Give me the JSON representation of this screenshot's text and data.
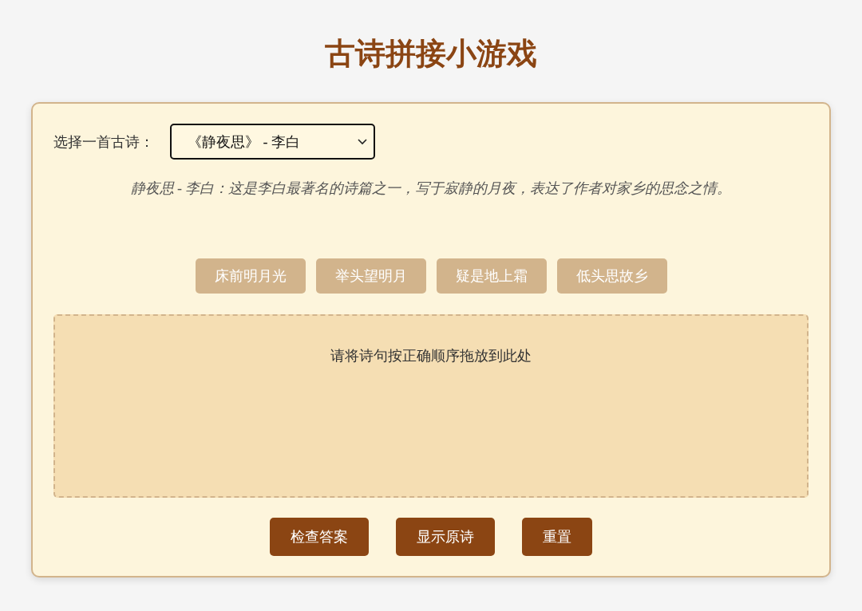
{
  "title": "古诗拼接小游戏",
  "selector": {
    "label": "选择一首古诗：",
    "value": "《静夜思》 - 李白"
  },
  "description": "静夜思 - 李白：这是李白最著名的诗篇之一，写于寂静的月夜，表达了作者对家乡的思念之情。",
  "lines": [
    "床前明月光",
    "举头望明月",
    "疑是地上霜",
    "低头思故乡"
  ],
  "drop_zone": {
    "placeholder": "请将诗句按正确顺序拖放到此处"
  },
  "buttons": [
    "检查答案",
    "显示原诗",
    "重置"
  ]
}
